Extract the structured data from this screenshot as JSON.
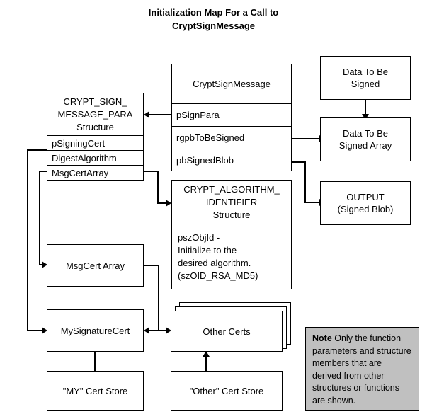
{
  "title": "Initialization Map For a Call to\nCryptSignMessage",
  "boxes": {
    "crypt_sign_message": {
      "header": "CryptSignMessage",
      "rows": [
        "pSignPara",
        "rgpbToBeSigned",
        "pbSignedBlob"
      ]
    },
    "sign_message_para": {
      "header": "CRYPT_SIGN_\nMESSAGE_PARA\nStructure",
      "rows": [
        "pSigningCert",
        "DigestAlgorithm",
        "MsgCertArray"
      ]
    },
    "algorithm_identifier": {
      "header": "CRYPT_ALGORITHM_\nIDENTIFIER\nStructure",
      "body": "pszObjId -\nInitialize to the\ndesired algorithm.\n(szOID_RSA_MD5)"
    },
    "data_to_be_signed": {
      "label": "Data To Be\nSigned"
    },
    "data_to_be_signed_array": {
      "label": "Data To Be\nSigned Array"
    },
    "output": {
      "label": "OUTPUT\n(Signed Blob)"
    },
    "msgcert_array": {
      "label": "MsgCert Array"
    },
    "mysignaturecert": {
      "label": "MySignatureCert"
    },
    "other_certs": {
      "label": "Other Certs"
    },
    "my_cert_store": {
      "label": "\"MY\" Cert Store"
    },
    "other_cert_store": {
      "label": "\"Other\" Cert Store"
    }
  },
  "note": {
    "bold_label": "Note",
    "text": "  Only the function parameters and structure members that are derived from other structures or functions are shown."
  },
  "colors": {
    "line": "#000000",
    "box_fill": "#ffffff",
    "note_fill": "#c0c0c0",
    "text": "#000000"
  }
}
